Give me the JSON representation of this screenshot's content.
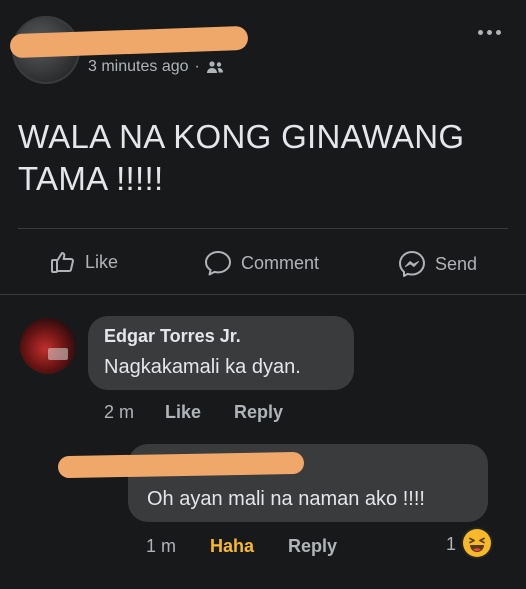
{
  "post": {
    "time": "3 minutes ago",
    "separator": "·",
    "audience_icon": "friends-icon",
    "text": "WALA NA KONG GINAWANG TAMA !!!!!"
  },
  "actions": {
    "like": "Like",
    "comment": "Comment",
    "send": "Send"
  },
  "comments": [
    {
      "author": "Edgar Torres Jr.",
      "text": "Nagkakamali ka dyan.",
      "time": "2 m",
      "like": "Like",
      "reply": "Reply"
    },
    {
      "text": "Oh ayan mali na naman ako !!!!",
      "time": "1 m",
      "reaction": "Haha",
      "reply": "Reply",
      "reaction_count": "1",
      "reaction_icon": "haha-emoji-icon"
    }
  ],
  "colors": {
    "background": "#18191a",
    "bubble": "#3a3b3c",
    "secondary_text": "#b0b3b8",
    "haha": "#f7b928"
  }
}
